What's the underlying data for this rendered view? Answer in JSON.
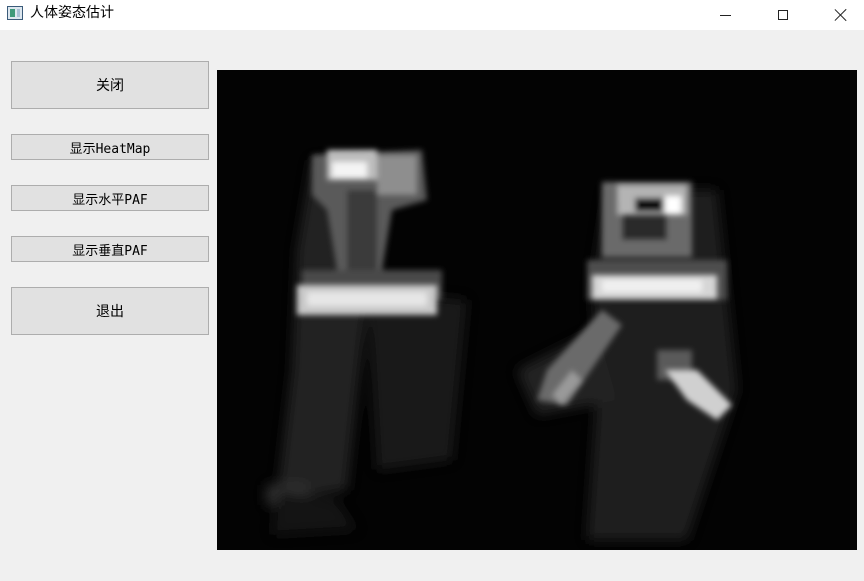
{
  "window": {
    "title": "人体姿态估计",
    "icon": "app-window-icon",
    "controls": [
      "minimize-icon",
      "maximize-icon",
      "close-icon"
    ]
  },
  "buttons": {
    "close": "关闭",
    "heatmap": "显示HeatMap",
    "paf_horizontal": "显示水平PAF",
    "paf_vertical": "显示垂直PAF",
    "exit": "退出"
  },
  "image": {
    "kind": "grayscale heatmap",
    "background_color": "#030303"
  }
}
